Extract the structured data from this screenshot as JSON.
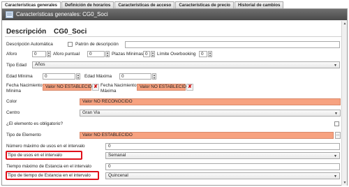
{
  "tabs": [
    "Características generales",
    "Definición de horarios",
    "Características de acceso",
    "Características de precio",
    "Historial de cambios"
  ],
  "header": {
    "title": "Características generales:  CG0_Soci",
    "icon": "form-icon"
  },
  "description": {
    "label": "Descripción",
    "value": "CG0_Soci"
  },
  "auto_desc": {
    "label": "Descripción Automática",
    "pattern_label": "Patrón de descripción",
    "pattern_value": ""
  },
  "capacity": {
    "aforo_label": "Aforo",
    "aforo_value": "0",
    "aforo_puntual_label": "Aforo puntual",
    "aforo_puntual_value": "0",
    "plazas_minimas_label": "Plazas Mínimas",
    "plazas_minimas_value": "0",
    "limite_label": "Límite Overbooking",
    "limite_value": "0"
  },
  "tipo_edad": {
    "label": "Tipo Edad",
    "value": "Años"
  },
  "edad": {
    "min_label": "Edad Mínima",
    "min_value": "0",
    "max_label": "Edad Máxima",
    "max_value": "0"
  },
  "fecha": {
    "min_label": "Fecha Nacimiento Mínima",
    "min_value": "Valor NO ESTABLECIDO",
    "max_label": "Fecha Nacimiento Máxima",
    "max_value": "Valor NO ESTABLECIDO"
  },
  "color": {
    "label": "Color",
    "value": "Valor NO RECONOCIDO"
  },
  "centro": {
    "label": "Centro",
    "value": "Gran Via"
  },
  "obligatorio": {
    "label": "¿El elemento es obligatorio?"
  },
  "tipo_elemento": {
    "label": "Tipo de Elemento",
    "value": "Valor NO ESTABLECIDO",
    "button": "..."
  },
  "numero_max": {
    "label": "Número máximo de usos en el intervalo",
    "value": "0"
  },
  "tipo_usos": {
    "label": "Tipo de usos en el intervalo",
    "value": "Semanal"
  },
  "tiempo_max": {
    "label": "Tiempo máximo de Estancia en el intervalo",
    "value": "0"
  },
  "tipo_tiempo": {
    "label": "Tipo de tiempo de Estancia en el intervalo",
    "value": "Quincenal"
  },
  "colors": {
    "header": "#5a5a5a",
    "orange_field": "#f7a280",
    "highlight": "#e0101a"
  }
}
